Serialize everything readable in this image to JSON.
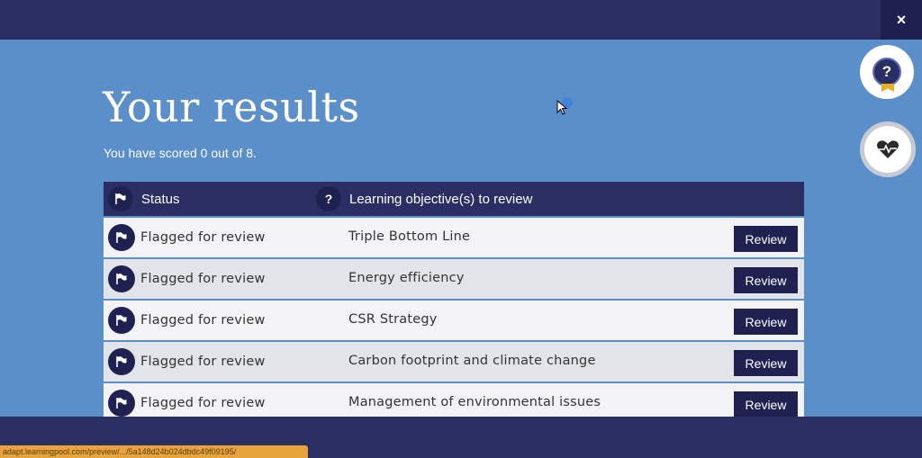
{
  "header": {
    "close_label": "×"
  },
  "main": {
    "title": "Your results",
    "score_text": "You have scored 0 out of 8."
  },
  "table": {
    "headers": {
      "status": "Status",
      "objective": "Learning objective(s) to review"
    },
    "rows": [
      {
        "status": "Flagged for review",
        "objective": "Triple Bottom Line",
        "button": "Review"
      },
      {
        "status": "Flagged for review",
        "objective": "Energy efficiency",
        "button": "Review"
      },
      {
        "status": "Flagged for review",
        "objective": "CSR Strategy",
        "button": "Review"
      },
      {
        "status": "Flagged for review",
        "objective": "Carbon footprint and climate change",
        "button": "Review"
      },
      {
        "status": "Flagged for review",
        "objective": "Management of environmental issues",
        "button": "Review"
      }
    ]
  },
  "side_buttons": {
    "help_symbol": "?"
  },
  "icons": {
    "flag": "flag-icon",
    "question": "question-icon",
    "heart": "heart-pulse-icon",
    "close": "close-icon"
  },
  "status_bar": {
    "url": "adapt.learningpool.com/preview/.../5a148d24b024dbdc49f09195/"
  },
  "colors": {
    "navy": "#2b2e63",
    "panel": "#5b8fca",
    "button": "#1f2250"
  }
}
